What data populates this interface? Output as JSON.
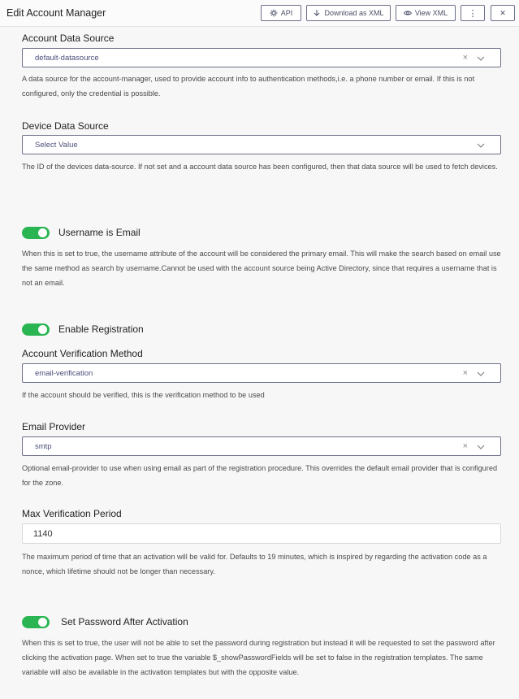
{
  "header": {
    "title": "Edit Account Manager",
    "api_label": "API",
    "download_label": "Download as XML",
    "view_label": "View XML",
    "more_symbol": "⋮",
    "close_symbol": "✕"
  },
  "account_data_source": {
    "label": "Account Data Source",
    "value": "default-datasource",
    "description": "A data source for the account-manager, used to provide account info to authentication methods,i.e. a phone number or email. If this is not configured, only the credential is possible."
  },
  "device_data_source": {
    "label": "Device Data Source",
    "placeholder": "Select Value",
    "description": "The ID of the devices data-source. If not set and a account data source has been configured, then that data source will be used to fetch devices."
  },
  "username_is_email": {
    "label": "Username is Email",
    "enabled": true,
    "description": "When this is set to true, the username attribute of the account will be considered the primary email. This will make the search based on email use the same method as search by username.Cannot be used with the account source being Active Directory, since that requires a username that is not an email."
  },
  "enable_registration": {
    "label": "Enable Registration",
    "enabled": true
  },
  "account_verification_method": {
    "label": "Account Verification Method",
    "value": "email-verification",
    "description": "If the account should be verified, this is the verification method to be used"
  },
  "email_provider": {
    "label": "Email Provider",
    "value": "smtp",
    "description": "Optional email-provider to use when using email as part of the registration procedure. This overrides the default email provider that is configured for the zone."
  },
  "max_verification_period": {
    "label": "Max Verification Period",
    "value": "1140",
    "description": "The maximum period of time that an activation will be valid for. Defaults to 19 minutes, which is inspired by regarding the activation code as a nonce, which lifetime should not be longer than necessary."
  },
  "set_password_after_activation": {
    "label": "Set Password After Activation",
    "enabled": true,
    "description": "When this is set to true, the user will not be able to set the password during registration but instead it will be requested to set the password after clicking the activation page. When set to true the variable $_showPasswordFields will be set to false in the registration templates. The same variable will also be available in the activation templates but with the opposite value."
  },
  "icons": {
    "clear": "×",
    "chevron": "chevron-down-icon",
    "api": "api-icon",
    "download": "download-icon",
    "view": "eye-icon"
  },
  "colors": {
    "toggle_on": "#2ab552",
    "select_border": "#6c7089"
  }
}
